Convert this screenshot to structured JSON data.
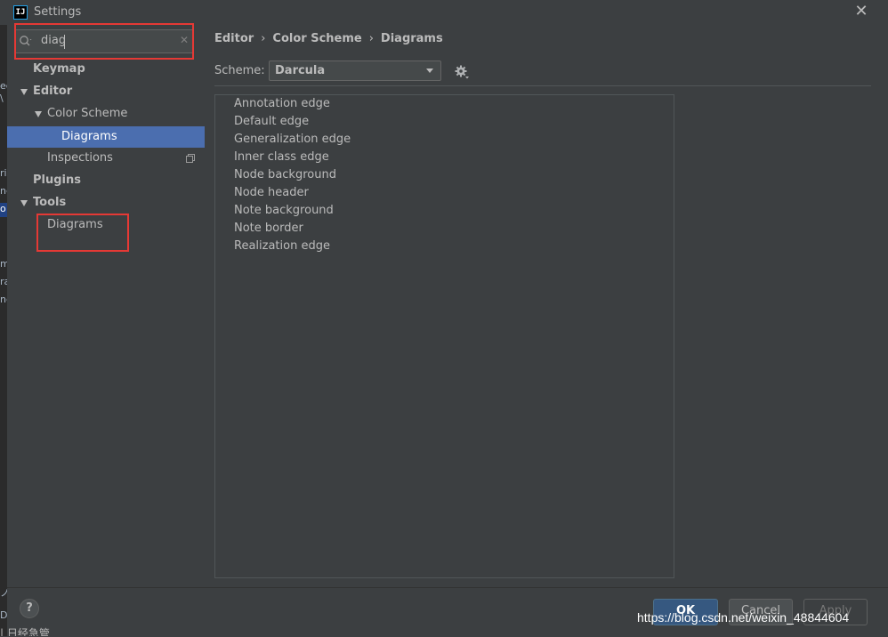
{
  "window": {
    "title": "Settings",
    "app_icon_label": "IJ"
  },
  "search": {
    "value": "diag"
  },
  "tree": {
    "keymap": "Keymap",
    "editor": "Editor",
    "color_scheme": "Color Scheme",
    "diagrams_selected": "Diagrams",
    "inspections": "Inspections",
    "plugins": "Plugins",
    "tools": "Tools",
    "tools_diagrams": "Diagrams"
  },
  "breadcrumb": [
    "Editor",
    "Color Scheme",
    "Diagrams"
  ],
  "breadcrumb_separator": "›",
  "scheme": {
    "label": "Scheme:",
    "value": "Darcula"
  },
  "list_items": [
    "Annotation edge",
    "Default edge",
    "Generalization edge",
    "Inner class edge",
    "Node background",
    "Node header",
    "Note background",
    "Note border",
    "Realization edge"
  ],
  "footer": {
    "help": "?",
    "ok": "OK",
    "cancel": "Cancel",
    "apply": "Apply"
  },
  "watermark": "https://blog.csdn.net/weixin_48844604",
  "ide_strip_fragments": [
    "ec",
    "\\",
    "ri",
    "ne",
    "o",
    "m",
    "ra",
    "ne",
    "ノ",
    "D"
  ],
  "bottom_fragment": "| 日经急管",
  "colors": {
    "dialog_bg": "#3c3f41",
    "selection": "#4b6eaf",
    "highlight_box": "#e53935",
    "ok_button": "#365880"
  }
}
